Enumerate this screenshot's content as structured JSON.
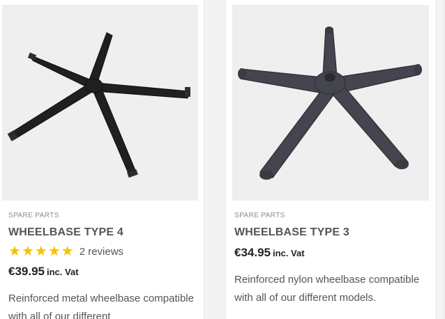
{
  "products": [
    {
      "image_alt": "metal wheelbase",
      "category": "SPARE PARTS",
      "title": "WHEELBASE TYPE 4",
      "rating": 5,
      "reviews": "2 reviews",
      "price": "€39.95",
      "vat": "inc. Vat",
      "description": "Reinforced metal wheelbase compatible with all of our different"
    },
    {
      "image_alt": "nylon wheelbase",
      "category": "SPARE PARTS",
      "title": "WHEELBASE TYPE 3",
      "price": "€34.95",
      "vat": "inc. Vat",
      "description": "Reinforced nylon wheelbase compatible with all of our different models."
    }
  ],
  "colors": {
    "star": "#f5c000",
    "title": "#555555",
    "price": "#222222",
    "image_bg": "#efefef"
  }
}
